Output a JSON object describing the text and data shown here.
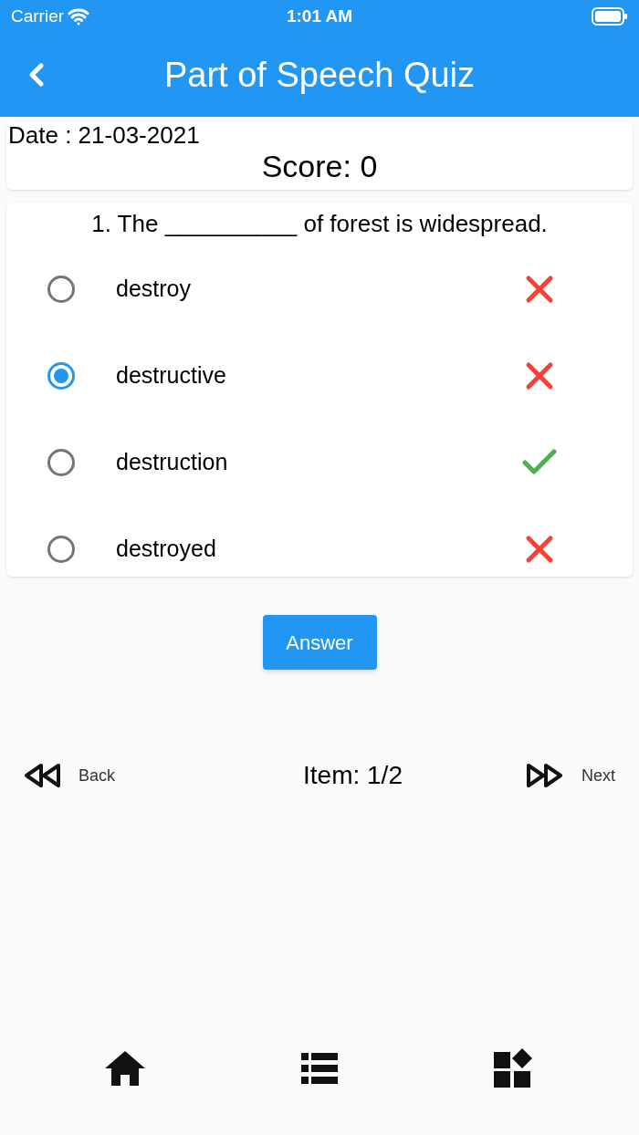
{
  "status_bar": {
    "carrier": "Carrier",
    "time": "1:01 AM"
  },
  "app_bar": {
    "title": "Part of Speech Quiz"
  },
  "header": {
    "date": "Date : 21-03-2021",
    "score": "Score: 0"
  },
  "question": {
    "text": "1. The __________ of forest is widespread.",
    "options": [
      {
        "label": "destroy",
        "selected": false,
        "correct": false
      },
      {
        "label": "destructive",
        "selected": true,
        "correct": false
      },
      {
        "label": "destruction",
        "selected": false,
        "correct": true
      },
      {
        "label": "destroyed",
        "selected": false,
        "correct": false
      }
    ]
  },
  "answer_button": "Answer",
  "navigation": {
    "back": "Back",
    "item": "Item: 1/2",
    "next": "Next"
  }
}
